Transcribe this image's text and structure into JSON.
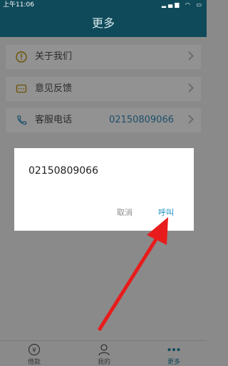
{
  "status_bar": {
    "time": "上午11:06"
  },
  "app_bar": {
    "title": "更多"
  },
  "menu": {
    "items": [
      {
        "label": "关于我们",
        "icon": "info-circle-icon"
      },
      {
        "label": "意见反馈",
        "icon": "feedback-icon"
      },
      {
        "label": "客服电话",
        "icon": "phone-icon",
        "value": "02150809066"
      }
    ]
  },
  "dialog": {
    "number": "02150809066",
    "cancel_label": "取消",
    "call_label": "呼叫"
  },
  "tabs": [
    {
      "label": "借款",
      "icon": "yen-cycle-icon"
    },
    {
      "label": "我的",
      "icon": "user-icon"
    },
    {
      "label": "更多",
      "icon": "more-dots-icon",
      "active": true
    }
  ],
  "colors": {
    "primary": "#0f4a5a",
    "accent": "#1b8ec2",
    "annotation": "#e81c1c"
  }
}
